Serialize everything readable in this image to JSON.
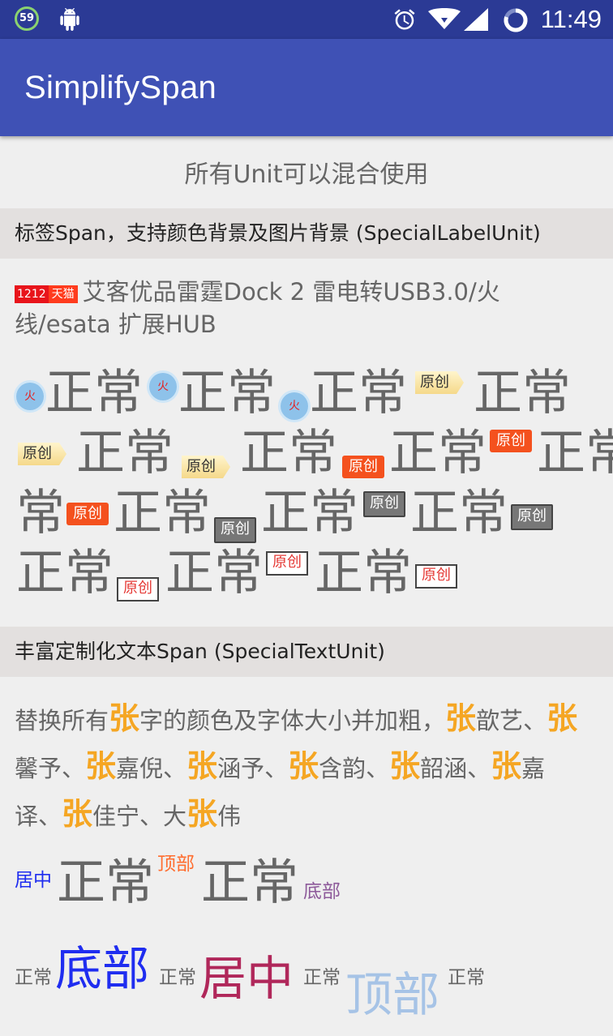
{
  "status_bar": {
    "notification_count": "59",
    "time": "11:49"
  },
  "app_bar": {
    "title": "SimplifySpan"
  },
  "intro": "所有Unit可以混合使用",
  "section1": {
    "header": "标签Span，支持颜色背景及图片背景 (SpecialLabelUnit)",
    "product": {
      "tag_1212": "1212",
      "tag_tmall": "天猫",
      "title": "艾客优品雷霆Dock 2 雷电转USB3.0/火线/esata 扩展HUB"
    },
    "normal": "正常",
    "fire": "火",
    "original": "原创"
  },
  "section2": {
    "header": "丰富定制化文本Span (SpecialTextUnit)",
    "rich": {
      "p1": "替换所有",
      "hl": "张",
      "p2": "字的颜色及字体大小并加粗，",
      "p3": "歆艺、",
      "p4": "馨予、",
      "p5": "嘉倪、",
      "p6": "涵予、",
      "p7": "含韵、",
      "p8": "韶涵、",
      "p9": "嘉译、",
      "p10": "佳宁、大",
      "p11": "伟"
    },
    "align_row1": {
      "center": "居中",
      "normal": "正常",
      "top": "顶部",
      "bottom": "底部"
    },
    "align_row2": {
      "normal": "正常",
      "bottom": "底部",
      "center": "居中",
      "top": "顶部"
    }
  },
  "colors": {
    "status_bar": "#2b3a95",
    "app_bar": "#3f51b5",
    "highlight": "#f5a623",
    "blue": "#1f2df0",
    "crimson": "#b0275a",
    "light_blue": "#a6c3e6",
    "purple": "#8d5a9a"
  }
}
